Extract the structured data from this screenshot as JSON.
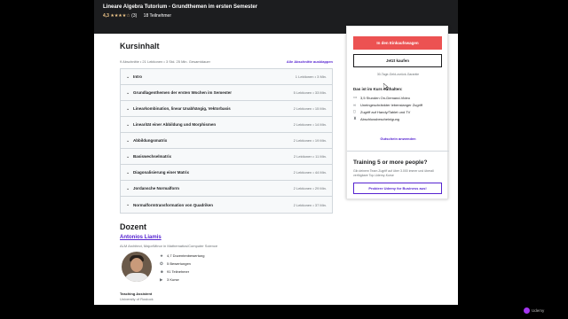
{
  "header": {
    "title": "Lineare Algebra Tutorium - Grundthemen im ersten Semester",
    "rating": "4,3",
    "stars": "★★★★☆",
    "rating_count": "(3)",
    "students": "18 Teilnehmer"
  },
  "course_content": {
    "heading": "Kursinhalt",
    "summary": "9 Abschnitte • 21 Lektionen • 3 Std. 25 Min. Gesamtdauer",
    "expand_all": "Alle Abschnitte ausklappen",
    "sections": [
      {
        "title": "Intro",
        "info": "1 Lektionen • 3 Min."
      },
      {
        "title": "Grundlagenthemen der ersten Wochen im Semester",
        "info": "5 Lektionen • 33 Min."
      },
      {
        "title": "Linearkombination, linear Unabhängig, Vektorbasis",
        "info": "2 Lektionen • 15 Min."
      },
      {
        "title": "Linearität einer Abbildung und Morphismen",
        "info": "2 Lektionen • 14 Min."
      },
      {
        "title": "Abbildungsmatrix",
        "info": "2 Lektionen • 19 Min."
      },
      {
        "title": "Basiswechselmatrix",
        "info": "2 Lektionen • 11 Min."
      },
      {
        "title": "Diagonalisierung einer Matrix",
        "info": "2 Lektionen • 44 Min."
      },
      {
        "title": "Jordansche Normalform",
        "info": "2 Lektionen • 29 Min."
      },
      {
        "title": "Normalformtransformation von Quadriken",
        "info": "2 Lektionen • 37 Min."
      }
    ]
  },
  "instructor": {
    "heading": "Dozent",
    "name": "Antonios Liamis",
    "subtitle": "ALM Architect, Major/Minor in Mathematics/Computer Science",
    "stats": [
      {
        "icon": "star-icon",
        "glyph": "★",
        "text": "4,7 Dozentenbewertung"
      },
      {
        "icon": "award-icon",
        "glyph": "✪",
        "text": "5 Bewertungen"
      },
      {
        "icon": "users-icon",
        "glyph": "☻",
        "text": "91 Teilnehmer"
      },
      {
        "icon": "play-icon",
        "glyph": "▶",
        "text": "3 Kurse"
      }
    ],
    "assistant_label": "Teaching Assistent",
    "assistant_sub": "University of Rostock"
  },
  "sidebar": {
    "add_to_cart": "In den Einkaufswagen",
    "buy_now": "Jetzt kaufen",
    "guarantee": "30-Tage-Geld-zurück-Garantie",
    "includes_heading": "Das ist im Kurs enthalten:",
    "includes": [
      {
        "icon": "video-icon",
        "glyph": "▭",
        "text": "3,5 Stunden On-Demand-Video"
      },
      {
        "icon": "infinity-icon",
        "glyph": "∞",
        "text": "Uneingeschränkter lebenslanger Zugriff"
      },
      {
        "icon": "mobile-icon",
        "glyph": "▯",
        "text": "Zugriff auf Handy/Tablet und TV"
      },
      {
        "icon": "certificate-icon",
        "glyph": "♜",
        "text": "Abschlussbescheinigung"
      }
    ],
    "coupon": "Gutschein anwenden",
    "training_heading": "Training 5 or more people?",
    "training_sub": "Gib deinem Team Zugriff auf über 3.000 immer und überall verfügbare Top-Udemy-Kurse",
    "business_button": "Probiere Udemy for Business aus!"
  },
  "watermark": "Udemy",
  "colors": {
    "accent_purple": "#5624d0",
    "cart_red": "#ec5252",
    "header_dark": "#1c1d1f",
    "star_gold": "#f3ca8c"
  }
}
